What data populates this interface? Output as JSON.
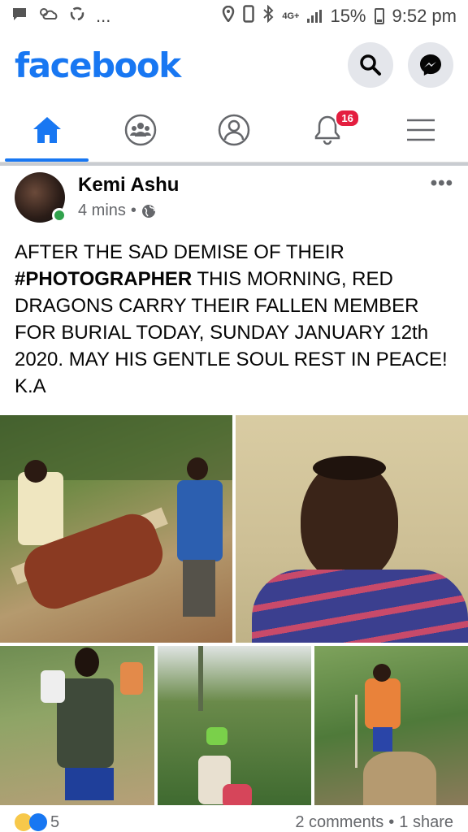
{
  "status_bar": {
    "battery": "15%",
    "time": "9:52 pm",
    "network": "4G+",
    "more": "..."
  },
  "header": {
    "logo": "facebook",
    "icons": [
      "search-icon",
      "messenger-icon"
    ]
  },
  "tabs": [
    {
      "name": "home",
      "icon": "home-icon",
      "active": true
    },
    {
      "name": "groups",
      "icon": "groups-icon",
      "active": false
    },
    {
      "name": "profile",
      "icon": "profile-icon",
      "active": false
    },
    {
      "name": "notifications",
      "icon": "bell-icon",
      "active": false,
      "badge": "16"
    },
    {
      "name": "menu",
      "icon": "menu-icon",
      "active": false
    }
  ],
  "post": {
    "author": "Kemi Ashu",
    "time": "4 mins",
    "separator": "•",
    "audience_icon": "globe-icon",
    "more": "•••",
    "text_part1": "AFTER THE SAD DEMISE OF THEIR ",
    "hashtag": "#PHOTOGRAPHER",
    "text_part2": " THIS MORNING, RED DRAGONS  CARRY THEIR FALLEN MEMBER FOR BURIAL TODAY, SUNDAY JANUARY 12th 2020. MAY HIS GENTLE SOUL REST IN PEACE! K.A"
  },
  "reactions": {
    "count": "5",
    "comments": "2 comments",
    "dot": "•",
    "shares": "1 share"
  },
  "colors": {
    "brand": "#1877f2",
    "badge": "#e41e3f",
    "online": "#31a24c"
  }
}
